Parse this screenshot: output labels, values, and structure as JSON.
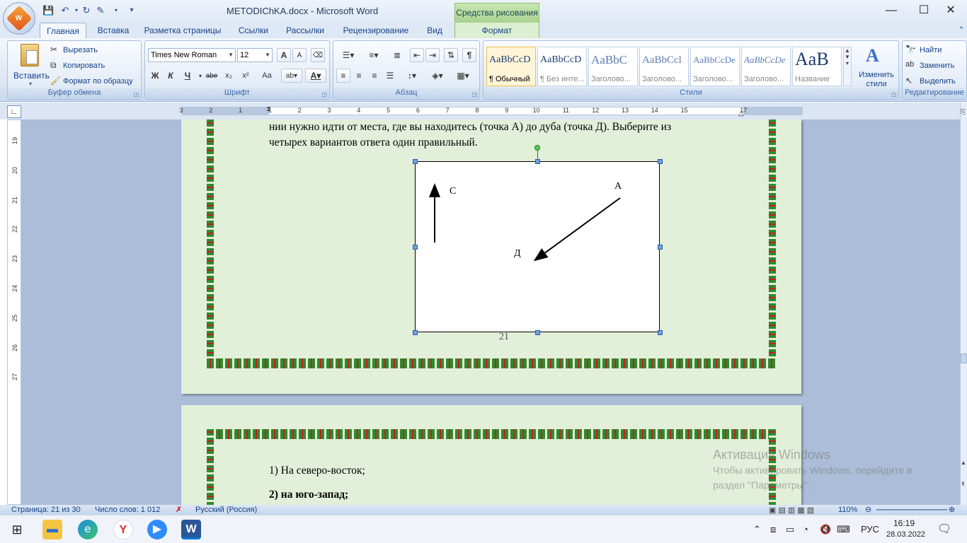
{
  "window": {
    "title": "METODIChKA.docx - Microsoft Word",
    "context_tab_header": "Средства рисования",
    "minimize": "—",
    "maximize": "☐",
    "close": "✕"
  },
  "office_button": {
    "logo_text": "W"
  },
  "tabs": [
    "Главная",
    "Вставка",
    "Разметка страницы",
    "Ссылки",
    "Рассылки",
    "Рецензирование",
    "Вид",
    "Формат"
  ],
  "clipboard": {
    "paste": "Вставить",
    "cut": "Вырезать",
    "copy": "Копировать",
    "format_painter": "Формат по образцу",
    "label": "Буфер обмена"
  },
  "font": {
    "name": "Times New Roman",
    "size": "12",
    "bold": "Ж",
    "italic": "К",
    "underline": "Ч",
    "strike": "abe",
    "subscript": "x₂",
    "superscript": "x²",
    "case": "Aa",
    "grow": "A",
    "shrink": "A",
    "label": "Шрифт",
    "text_color": "#cc0000"
  },
  "paragraph": {
    "label": "Абзац",
    "pilcrow": "¶"
  },
  "styles": {
    "label": "Стили",
    "items": [
      {
        "sample": "AaBbCcD",
        "name": "¶ Обычный"
      },
      {
        "sample": "AaBbCcD",
        "name": "¶ Без инте..."
      },
      {
        "sample": "AaBbC",
        "name": "Заголово..."
      },
      {
        "sample": "AaBbCcl",
        "name": "Заголово..."
      },
      {
        "sample": "AaBbCcDe",
        "name": "Заголово..."
      },
      {
        "sample": "AaBbCcDe",
        "name": "Заголово..."
      },
      {
        "sample": "AaB",
        "name": "Название"
      }
    ],
    "change_styles": "Изменить стили"
  },
  "editing": {
    "label": "Редактирование",
    "find": "Найти",
    "replace": "Заменить",
    "select": "Выделить"
  },
  "ruler": {
    "ticks": [
      "3",
      "2",
      "1",
      "1",
      "2",
      "3",
      "4",
      "5",
      "6",
      "7",
      "8",
      "9",
      "10",
      "11",
      "12",
      "13",
      "14",
      "15",
      "17"
    ],
    "v_ticks": [
      "19",
      "20",
      "21",
      "22",
      "23",
      "24",
      "25",
      "26",
      "27"
    ]
  },
  "document": {
    "line1": "нии нужно идти от места, где вы находитесь (точка А) до дуба (точка Д). Выберите из",
    "line2": "четырех вариантов ответа один правильный.",
    "label_c": "С",
    "label_a": "А",
    "label_d": "Д",
    "page_number": "21",
    "answer1": "1) На северо-восток;",
    "answer2": "2) на юго-запад;"
  },
  "status": {
    "page": "Страница: 21 из 30",
    "words": "Число слов: 1 012",
    "language": "Русский (Россия)",
    "zoom": "110%"
  },
  "watermark": {
    "title": "Активация Windows",
    "line1": "Чтобы активировать Windows, перейдите в",
    "line2": "раздел \"Параметры\"."
  },
  "taskbar": {
    "lang": "РУС",
    "time": "16:19",
    "date": "28.03.2022"
  }
}
